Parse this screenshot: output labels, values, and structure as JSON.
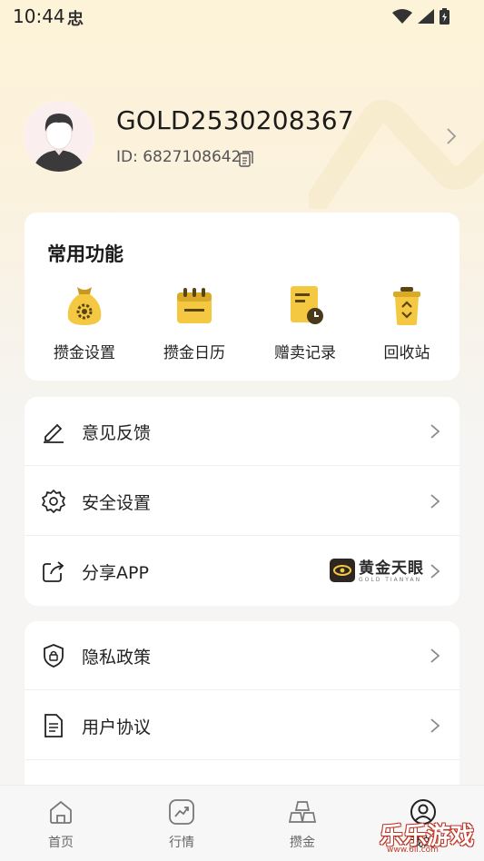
{
  "status_bar": {
    "time": "10:44",
    "app_glyph": "忠"
  },
  "profile": {
    "username": "GOLD2530208367",
    "id_text": "ID: 6827108642"
  },
  "common_functions": {
    "title": "常用功能",
    "items": [
      {
        "label": "攒金设置",
        "icon": "money-bag-gear-icon"
      },
      {
        "label": "攒金日历",
        "icon": "calendar-icon"
      },
      {
        "label": "赠卖记录",
        "icon": "record-clock-icon"
      },
      {
        "label": "回收站",
        "icon": "recycle-bin-icon"
      }
    ]
  },
  "menu1": [
    {
      "label": "意见反馈",
      "icon": "pencil-icon"
    },
    {
      "label": "安全设置",
      "icon": "gear-icon"
    },
    {
      "label": "分享APP",
      "icon": "share-icon",
      "brand": {
        "name": "黄金天眼",
        "sub": "GOLD TIANYAN"
      }
    }
  ],
  "menu2": [
    {
      "label": "隐私政策",
      "icon": "shield-lock-icon"
    },
    {
      "label": "用户协议",
      "icon": "document-icon"
    }
  ],
  "tabs": [
    {
      "label": "首页",
      "icon": "home-icon"
    },
    {
      "label": "行情",
      "icon": "chart-icon"
    },
    {
      "label": "攒金",
      "icon": "gold-bars-icon"
    },
    {
      "label": "我的",
      "icon": "profile-icon"
    }
  ],
  "watermark": {
    "text": "乐乐游戏",
    "url": "www.6ll.com"
  },
  "colors": {
    "accent_gold": "#f5c842",
    "page_bg": "#f6f5f3",
    "card_bg": "#ffffff"
  }
}
